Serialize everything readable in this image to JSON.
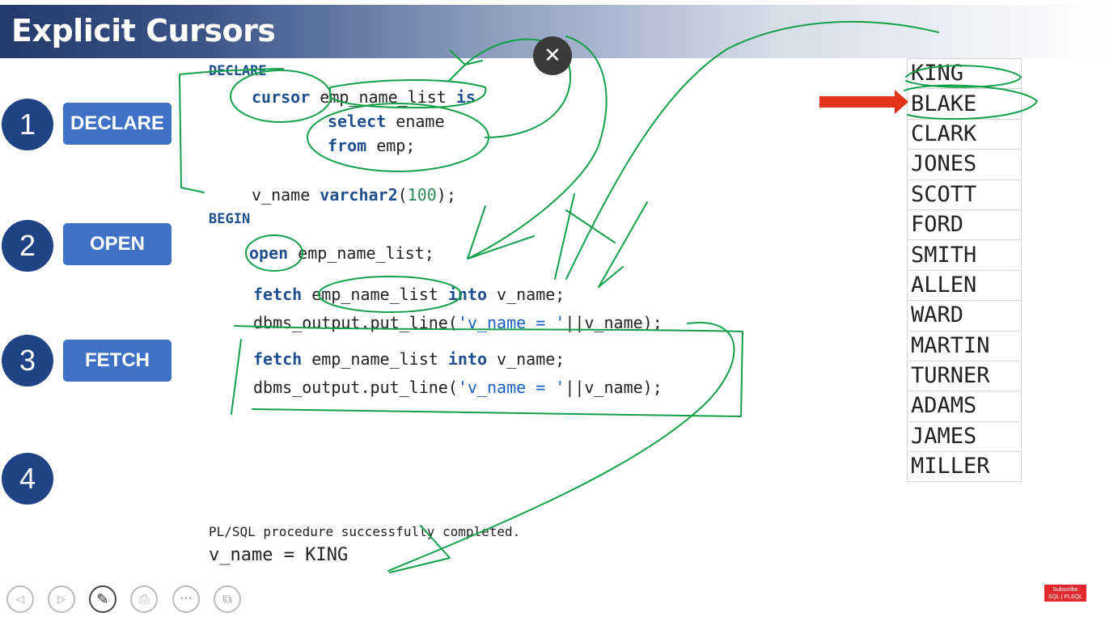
{
  "slide": {
    "title": "Explicit Cursors",
    "steps": [
      {
        "number": "1",
        "label": "DECLARE"
      },
      {
        "number": "2",
        "label": "OPEN"
      },
      {
        "number": "3",
        "label": "FETCH"
      },
      {
        "number": "4",
        "label": ""
      }
    ]
  },
  "code": {
    "declare_kw": "DECLARE",
    "cursor_kw": "cursor",
    "cursor_name": " emp_name_list ",
    "is_kw": "is",
    "select_kw": "select",
    "select_col": " ename",
    "from_kw": "from",
    "from_tbl": " emp;",
    "var_name": "v_name ",
    "var_type": "varchar2",
    "var_paren_open": "(",
    "var_size": "100",
    "var_paren_close": ");",
    "begin_kw": "BEGIN",
    "open_kw": "open",
    "open_rest": " emp_name_list;",
    "fetch_kw": "fetch",
    "fetch_cursor": " emp_name_list ",
    "into_kw": "into",
    "fetch_var": " v_name;",
    "put_line_prefix": "dbms_output.put_line(",
    "put_line_string": "'v_name = '",
    "put_line_suffix": "||v_name);"
  },
  "output": {
    "status": "PL/SQL procedure successfully completed.",
    "value": "v_name = KING"
  },
  "names_table": [
    "KING",
    "BLAKE",
    "CLARK",
    "JONES",
    "SCOTT",
    "FORD",
    "SMITH",
    "ALLEN",
    "WARD",
    "MARTIN",
    "TURNER",
    "ADAMS",
    "JAMES",
    "MILLER"
  ],
  "controls": {
    "close_glyph": "✕",
    "nav_prev_glyph": "◁",
    "nav_next_glyph": "▷",
    "pen_glyph": "✎",
    "export_glyph": "⎙",
    "more_glyph": "•••",
    "screen_glyph": "⧉"
  },
  "badge": {
    "line1": "Subscribe",
    "line2": "SQL | PLSQL"
  },
  "colors": {
    "title_bar_dark": "#233a6a",
    "step_circle": "#1f4385",
    "step_label": "#3f72c5",
    "keyword": "#1f4f8e",
    "string": "#1a5fc0",
    "number": "#2e8b57",
    "annotation_ink": "#13a049",
    "arrow": "#e2321a",
    "badge": "#e0282e"
  }
}
